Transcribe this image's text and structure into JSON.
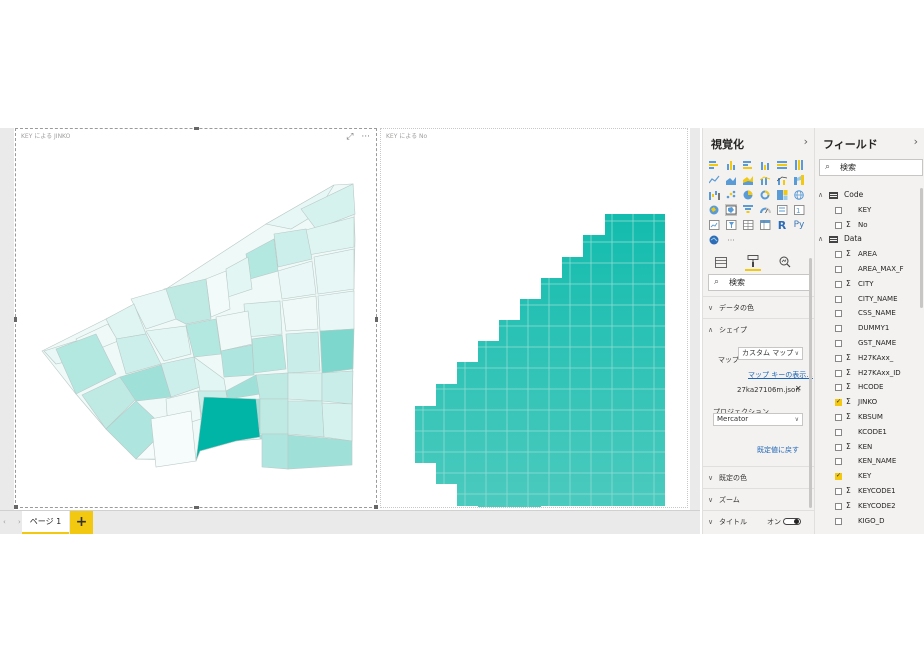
{
  "canvas": {
    "visual1": {
      "title": "KEY による JINKO"
    },
    "visual2": {
      "title": "KEY による No"
    },
    "icons": {
      "focus": "focus-mode-icon",
      "more": "more-options-icon"
    },
    "fill_colors": {
      "light": "#e6f7f5",
      "mid": "#9fe1d9",
      "dark": "#00b5a5",
      "grid_top": "#13bcae",
      "grid_bottom": "#45c9bc",
      "border": "#9a9a9a"
    }
  },
  "pages": {
    "tabs": [
      {
        "label": "ページ 1"
      }
    ],
    "add_label": "+"
  },
  "viz_pane": {
    "title": "視覚化",
    "search_placeholder": "検索",
    "more_label": "···",
    "r_label": "R",
    "py_label": "Py",
    "sections": {
      "data_colors": "データの色",
      "shape": "シェイプ",
      "default_colors": "既定の色",
      "zoom": "ズーム",
      "title": "タイトル"
    },
    "shape": {
      "map_label": "マップ",
      "map_value": "カスタム マップ",
      "map_keys_link": "マップ キーの表示...",
      "file_name": "27ka27106m.json",
      "projection_label": "プロジェクション",
      "projection_value": "Mercator",
      "reset_link": "既定値に戻す"
    },
    "title_toggle": "オン"
  },
  "fields_pane": {
    "title": "フィールド",
    "search_placeholder": "検索",
    "tables": [
      {
        "name": "Code",
        "fields": [
          {
            "label": "KEY",
            "sigma": false,
            "checked": false
          },
          {
            "label": "No",
            "sigma": true,
            "checked": false
          }
        ]
      },
      {
        "name": "Data",
        "fields": [
          {
            "label": "AREA",
            "sigma": true,
            "checked": false
          },
          {
            "label": "AREA_MAX_F",
            "sigma": false,
            "checked": false
          },
          {
            "label": "CITY",
            "sigma": true,
            "checked": false
          },
          {
            "label": "CITY_NAME",
            "sigma": false,
            "checked": false
          },
          {
            "label": "CSS_NAME",
            "sigma": false,
            "checked": false
          },
          {
            "label": "DUMMY1",
            "sigma": false,
            "checked": false
          },
          {
            "label": "GST_NAME",
            "sigma": false,
            "checked": false
          },
          {
            "label": "H27KAxx_",
            "sigma": true,
            "checked": false
          },
          {
            "label": "H27KAxx_ID",
            "sigma": true,
            "checked": false
          },
          {
            "label": "HCODE",
            "sigma": true,
            "checked": false
          },
          {
            "label": "JINKO",
            "sigma": true,
            "checked": true
          },
          {
            "label": "KBSUM",
            "sigma": true,
            "checked": false
          },
          {
            "label": "KCODE1",
            "sigma": false,
            "checked": false
          },
          {
            "label": "KEN",
            "sigma": true,
            "checked": false
          },
          {
            "label": "KEN_NAME",
            "sigma": false,
            "checked": false
          },
          {
            "label": "KEY",
            "sigma": false,
            "checked": true
          },
          {
            "label": "KEYCODE1",
            "sigma": true,
            "checked": false
          },
          {
            "label": "KEYCODE2",
            "sigma": true,
            "checked": false
          },
          {
            "label": "KIGO_D",
            "sigma": false,
            "checked": false
          }
        ]
      }
    ]
  }
}
